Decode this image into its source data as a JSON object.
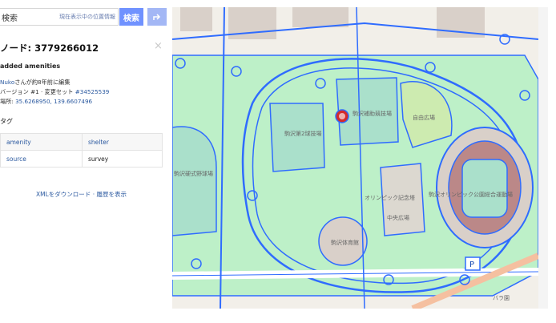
{
  "search": {
    "value": "検索",
    "where_am_i": "現在表示中の位置情報",
    "button_label": "検索",
    "directions_icon": "directions-icon"
  },
  "feature": {
    "title": "ノード: 3779266012",
    "close_icon": "close-icon",
    "changeset_comment": "added amenities",
    "edited_by_user": "Nuko",
    "edited_by_suffix": "さんが約8年前に編集",
    "version_prefix": "バージョン #1 · 変更セット ",
    "changeset_id": "#34525539",
    "location_label": "場所: ",
    "location_value": "35.6268950, 139.6607496"
  },
  "tags": {
    "heading": "タグ",
    "rows": [
      {
        "key": "amenity",
        "value": "shelter"
      },
      {
        "key": "source",
        "value": "survey"
      }
    ]
  },
  "links": {
    "download_xml": "XMLをダウンロード",
    "separator": " · ",
    "view_history": "履歴を表示"
  },
  "map": {
    "colors": {
      "park": "#bdf0c8",
      "pitch": "#aae0cb",
      "highlight": "#2f6cff",
      "road": "#ffffff",
      "building": "#d9d0c9",
      "selected": "#d42b2b"
    },
    "labels": {
      "pitch_2": "駒沢第2球技場",
      "pitch_hojo": "駒沢補助競技場",
      "plaza_jiyu": "自由広場",
      "hard_baseball": "駒沢硬式野球場",
      "olympic_memorial": "オリンピック記念塔",
      "central_plaza": "中央広場",
      "gym": "駒沢体育館",
      "olympic_park": "駒沢オリンピック公園総合運動場",
      "rose_garden": "バラ園",
      "parking": "P"
    }
  }
}
